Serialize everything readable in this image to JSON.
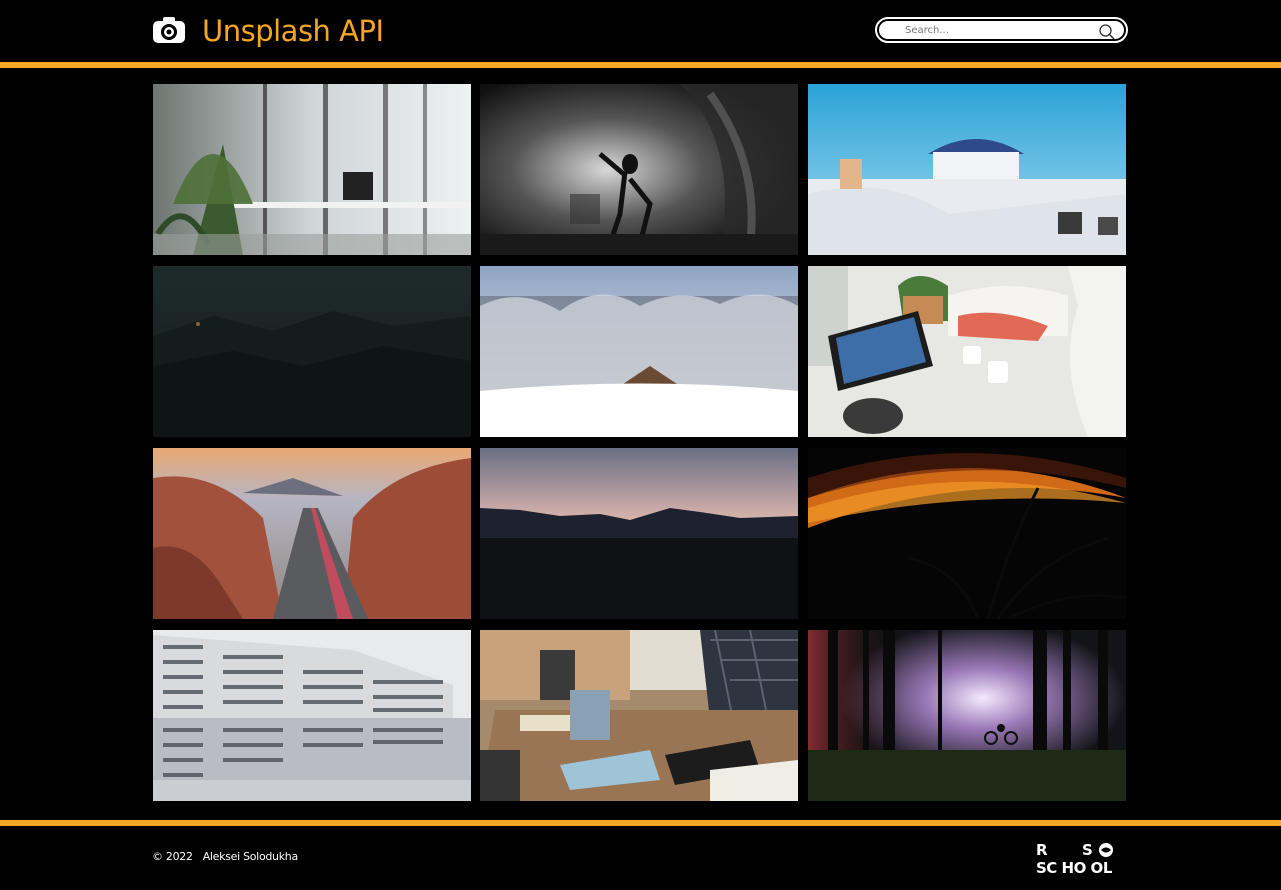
{
  "header": {
    "title": "Unsplash API",
    "logo_icon": "camera-icon",
    "search": {
      "placeholder": "Search...",
      "value": "",
      "icon": "search-icon"
    }
  },
  "gallery": {
    "photos": [
      {
        "subject": "office-interior"
      },
      {
        "subject": "dancer-studio"
      },
      {
        "subject": "white-church-dome"
      },
      {
        "subject": "dark-mountains"
      },
      {
        "subject": "snowy-forest-cabin"
      },
      {
        "subject": "tablet-tea-table"
      },
      {
        "subject": "red-rock-canyon-road"
      },
      {
        "subject": "dusk-mountain-silhouette"
      },
      {
        "subject": "orange-glow-plant"
      },
      {
        "subject": "white-building-reflection"
      },
      {
        "subject": "architect-desk"
      },
      {
        "subject": "foggy-forest-cyclist"
      }
    ]
  },
  "footer": {
    "year": "© 2022",
    "author": "Aleksei Solodukha",
    "school_logo_text": "RS SCHOOL"
  },
  "colors": {
    "accent": "#f5a623",
    "background": "#000000",
    "text": "#ffffff"
  }
}
